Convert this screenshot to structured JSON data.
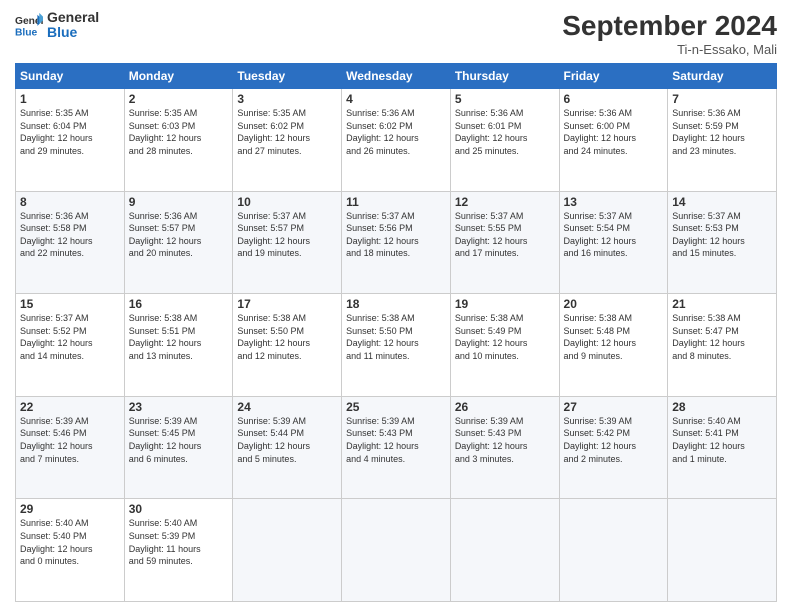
{
  "header": {
    "logo_general": "General",
    "logo_blue": "Blue",
    "month_title": "September 2024",
    "location": "Ti-n-Essako, Mali"
  },
  "weekdays": [
    "Sunday",
    "Monday",
    "Tuesday",
    "Wednesday",
    "Thursday",
    "Friday",
    "Saturday"
  ],
  "weeks": [
    [
      {
        "day": "1",
        "text": "Sunrise: 5:35 AM\nSunset: 6:04 PM\nDaylight: 12 hours\nand 29 minutes."
      },
      {
        "day": "2",
        "text": "Sunrise: 5:35 AM\nSunset: 6:03 PM\nDaylight: 12 hours\nand 28 minutes."
      },
      {
        "day": "3",
        "text": "Sunrise: 5:35 AM\nSunset: 6:02 PM\nDaylight: 12 hours\nand 27 minutes."
      },
      {
        "day": "4",
        "text": "Sunrise: 5:36 AM\nSunset: 6:02 PM\nDaylight: 12 hours\nand 26 minutes."
      },
      {
        "day": "5",
        "text": "Sunrise: 5:36 AM\nSunset: 6:01 PM\nDaylight: 12 hours\nand 25 minutes."
      },
      {
        "day": "6",
        "text": "Sunrise: 5:36 AM\nSunset: 6:00 PM\nDaylight: 12 hours\nand 24 minutes."
      },
      {
        "day": "7",
        "text": "Sunrise: 5:36 AM\nSunset: 5:59 PM\nDaylight: 12 hours\nand 23 minutes."
      }
    ],
    [
      {
        "day": "8",
        "text": "Sunrise: 5:36 AM\nSunset: 5:58 PM\nDaylight: 12 hours\nand 22 minutes."
      },
      {
        "day": "9",
        "text": "Sunrise: 5:36 AM\nSunset: 5:57 PM\nDaylight: 12 hours\nand 20 minutes."
      },
      {
        "day": "10",
        "text": "Sunrise: 5:37 AM\nSunset: 5:57 PM\nDaylight: 12 hours\nand 19 minutes."
      },
      {
        "day": "11",
        "text": "Sunrise: 5:37 AM\nSunset: 5:56 PM\nDaylight: 12 hours\nand 18 minutes."
      },
      {
        "day": "12",
        "text": "Sunrise: 5:37 AM\nSunset: 5:55 PM\nDaylight: 12 hours\nand 17 minutes."
      },
      {
        "day": "13",
        "text": "Sunrise: 5:37 AM\nSunset: 5:54 PM\nDaylight: 12 hours\nand 16 minutes."
      },
      {
        "day": "14",
        "text": "Sunrise: 5:37 AM\nSunset: 5:53 PM\nDaylight: 12 hours\nand 15 minutes."
      }
    ],
    [
      {
        "day": "15",
        "text": "Sunrise: 5:37 AM\nSunset: 5:52 PM\nDaylight: 12 hours\nand 14 minutes."
      },
      {
        "day": "16",
        "text": "Sunrise: 5:38 AM\nSunset: 5:51 PM\nDaylight: 12 hours\nand 13 minutes."
      },
      {
        "day": "17",
        "text": "Sunrise: 5:38 AM\nSunset: 5:50 PM\nDaylight: 12 hours\nand 12 minutes."
      },
      {
        "day": "18",
        "text": "Sunrise: 5:38 AM\nSunset: 5:50 PM\nDaylight: 12 hours\nand 11 minutes."
      },
      {
        "day": "19",
        "text": "Sunrise: 5:38 AM\nSunset: 5:49 PM\nDaylight: 12 hours\nand 10 minutes."
      },
      {
        "day": "20",
        "text": "Sunrise: 5:38 AM\nSunset: 5:48 PM\nDaylight: 12 hours\nand 9 minutes."
      },
      {
        "day": "21",
        "text": "Sunrise: 5:38 AM\nSunset: 5:47 PM\nDaylight: 12 hours\nand 8 minutes."
      }
    ],
    [
      {
        "day": "22",
        "text": "Sunrise: 5:39 AM\nSunset: 5:46 PM\nDaylight: 12 hours\nand 7 minutes."
      },
      {
        "day": "23",
        "text": "Sunrise: 5:39 AM\nSunset: 5:45 PM\nDaylight: 12 hours\nand 6 minutes."
      },
      {
        "day": "24",
        "text": "Sunrise: 5:39 AM\nSunset: 5:44 PM\nDaylight: 12 hours\nand 5 minutes."
      },
      {
        "day": "25",
        "text": "Sunrise: 5:39 AM\nSunset: 5:43 PM\nDaylight: 12 hours\nand 4 minutes."
      },
      {
        "day": "26",
        "text": "Sunrise: 5:39 AM\nSunset: 5:43 PM\nDaylight: 12 hours\nand 3 minutes."
      },
      {
        "day": "27",
        "text": "Sunrise: 5:39 AM\nSunset: 5:42 PM\nDaylight: 12 hours\nand 2 minutes."
      },
      {
        "day": "28",
        "text": "Sunrise: 5:40 AM\nSunset: 5:41 PM\nDaylight: 12 hours\nand 1 minute."
      }
    ],
    [
      {
        "day": "29",
        "text": "Sunrise: 5:40 AM\nSunset: 5:40 PM\nDaylight: 12 hours\nand 0 minutes."
      },
      {
        "day": "30",
        "text": "Sunrise: 5:40 AM\nSunset: 5:39 PM\nDaylight: 11 hours\nand 59 minutes."
      },
      {
        "day": "",
        "text": ""
      },
      {
        "day": "",
        "text": ""
      },
      {
        "day": "",
        "text": ""
      },
      {
        "day": "",
        "text": ""
      },
      {
        "day": "",
        "text": ""
      }
    ]
  ]
}
